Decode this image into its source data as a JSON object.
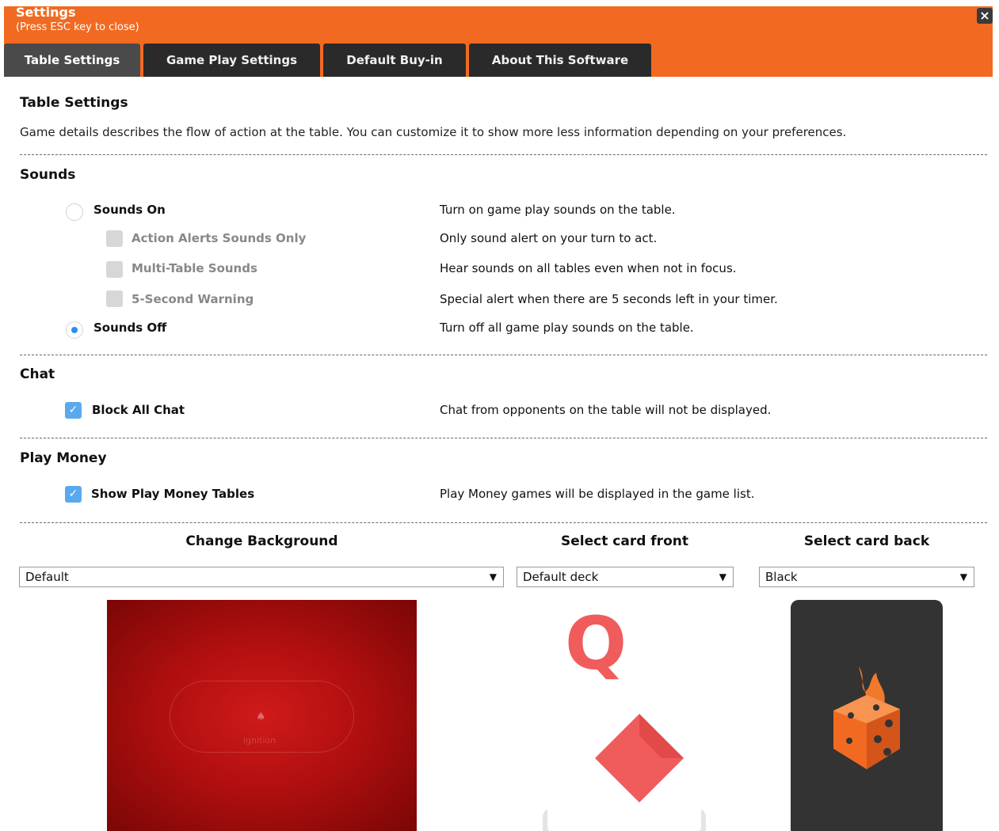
{
  "header": {
    "title": "Settings",
    "subtitle": "(Press ESC key to close)",
    "close": "×"
  },
  "tabs": [
    {
      "label": "Table Settings",
      "active": true
    },
    {
      "label": "Game Play Settings",
      "active": false
    },
    {
      "label": "Default Buy-in",
      "active": false
    },
    {
      "label": "About This Software",
      "active": false
    }
  ],
  "content": {
    "heading": "Table Settings",
    "description": "Game details describes the flow of action at the table. You can customize it to show more less information depending on your preferences."
  },
  "sounds": {
    "heading": "Sounds",
    "options": [
      {
        "label": "Sounds On",
        "desc": "Turn on game play sounds on the table.",
        "type": "radio",
        "selected": false
      },
      {
        "label": "Action Alerts Sounds Only",
        "desc": "Only sound alert on your turn to act.",
        "type": "checkbox",
        "disabled": true
      },
      {
        "label": "Multi-Table Sounds",
        "desc": "Hear sounds on all tables even when not in focus.",
        "type": "checkbox",
        "disabled": true
      },
      {
        "label": "5-Second Warning",
        "desc": "Special alert when there are 5 seconds left in your timer.",
        "type": "checkbox",
        "disabled": true
      },
      {
        "label": "Sounds Off",
        "desc": "Turn off all game play sounds on the table.",
        "type": "radio",
        "selected": true
      }
    ]
  },
  "chat": {
    "heading": "Chat",
    "option": {
      "label": "Block All Chat",
      "desc": "Chat from opponents on the table will not be displayed.",
      "checked": true
    }
  },
  "play_money": {
    "heading": "Play Money",
    "option": {
      "label": "Show Play Money Tables",
      "desc": "Play Money games will be displayed in the game list.",
      "checked": true
    }
  },
  "appearance": {
    "background": {
      "title": "Change Background",
      "value": "Default"
    },
    "card_front": {
      "title": "Select card front",
      "value": "Default deck",
      "rank": "Q",
      "suit": "diamond"
    },
    "card_back": {
      "title": "Select card back",
      "value": "Black"
    }
  },
  "colors": {
    "accent": "#f26a21",
    "tab_bg": "#2a2a2a",
    "check_blue": "#5aa9ef",
    "radio_blue": "#2b8ef0",
    "suit_red": "#f05c5c",
    "table_red": "#c41414",
    "card_back": "#333333"
  }
}
